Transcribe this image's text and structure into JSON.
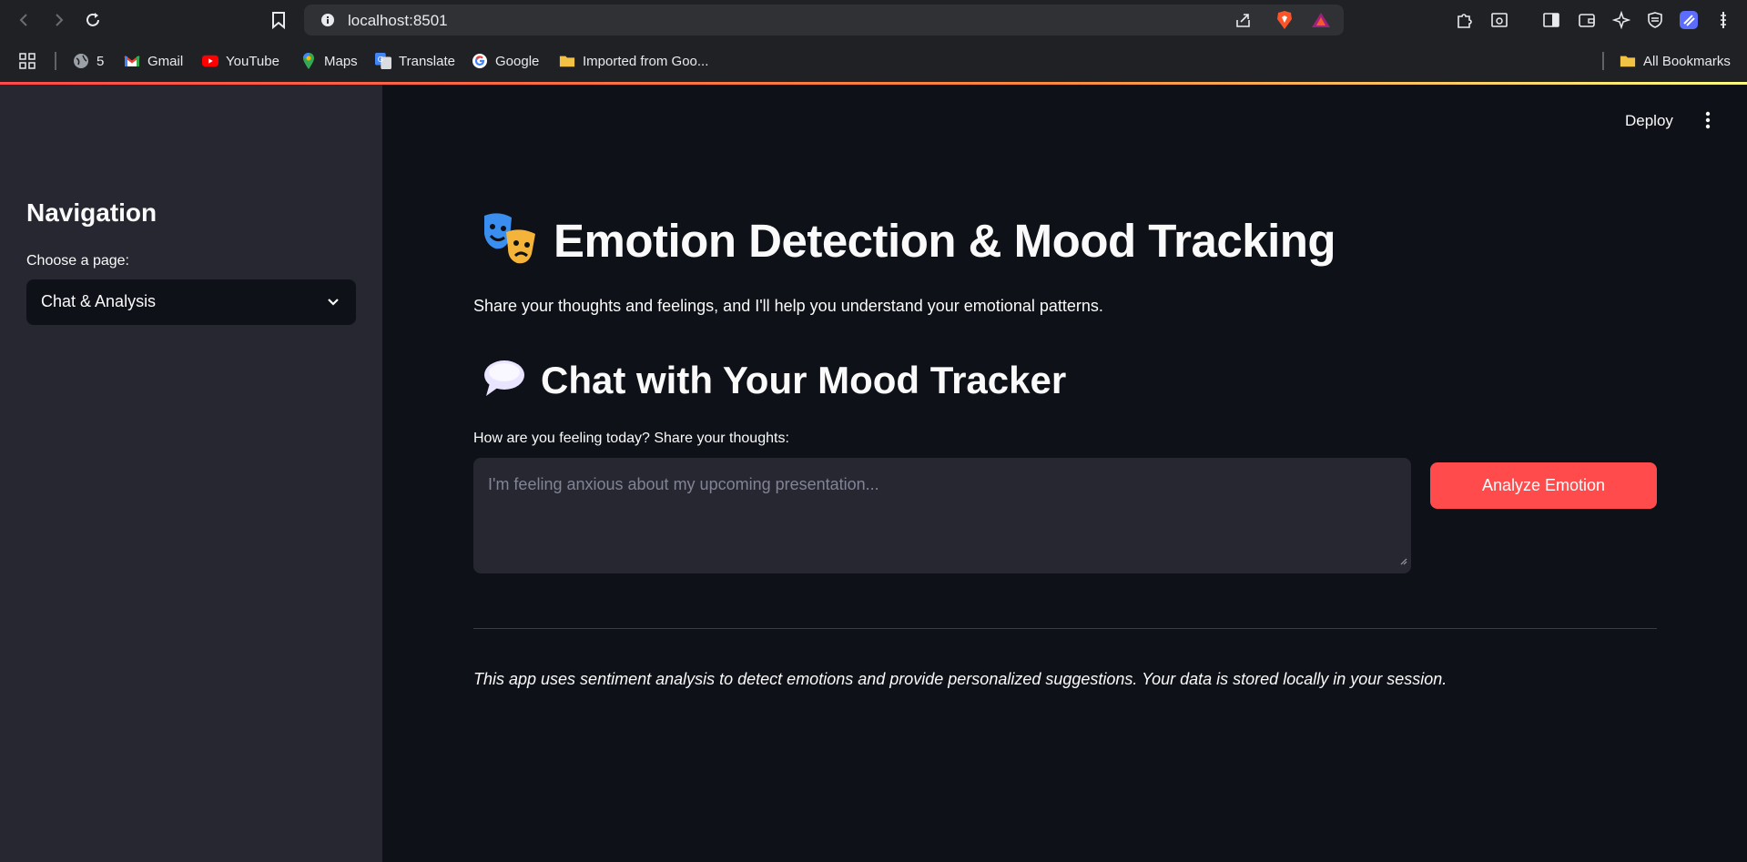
{
  "browser": {
    "url": "localhost:8501",
    "bookmarks": {
      "count_label": "5",
      "items": [
        "Gmail",
        "YouTube",
        "Maps",
        "Translate",
        "Google",
        "Imported from Goo..."
      ],
      "all_label": "All Bookmarks"
    }
  },
  "sidebar": {
    "title": "Navigation",
    "choose_label": "Choose a page:",
    "selected_page": "Chat & Analysis"
  },
  "header": {
    "deploy_label": "Deploy"
  },
  "main": {
    "title": "Emotion Detection & Mood Tracking",
    "subtitle": "Share your thoughts and feelings, and I'll help you understand your emotional patterns.",
    "chat_heading": "Chat with Your Mood Tracker",
    "input_label": "How are you feeling today? Share your thoughts:",
    "input_placeholder": "I'm feeling anxious about my upcoming presentation...",
    "analyze_button": "Analyze Emotion",
    "footer_note": "This app uses sentiment analysis to detect emotions and provide personalized suggestions. Your data is stored locally in your session."
  },
  "colors": {
    "accent": "#ff4b4b",
    "sidebar_bg": "#262730",
    "main_bg": "#0e1117",
    "text": "#fafafa"
  },
  "icons": {
    "title_icon": "performing-arts-masks-icon",
    "chat_icon": "speech-balloon-icon"
  }
}
